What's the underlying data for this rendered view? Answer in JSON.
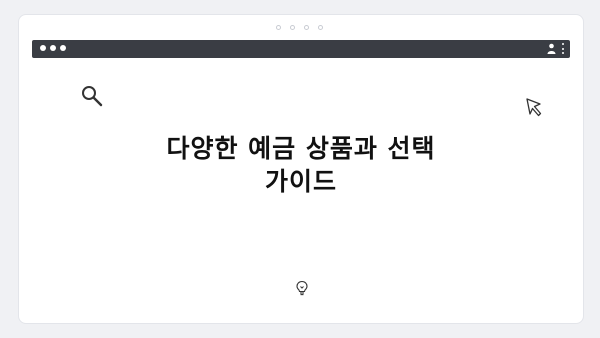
{
  "headline": {
    "line1": "다양한 예금 상품과 선택",
    "line2": "가이드"
  },
  "colors": {
    "background": "#f0f1f4",
    "card": "#ffffff",
    "browser_bar": "#3a3d44",
    "text": "#111111",
    "icon_stroke": "#333333"
  },
  "icons": [
    "search-icon",
    "cursor-icon",
    "lightbulb-icon",
    "user-icon",
    "kebab-menu-icon"
  ]
}
